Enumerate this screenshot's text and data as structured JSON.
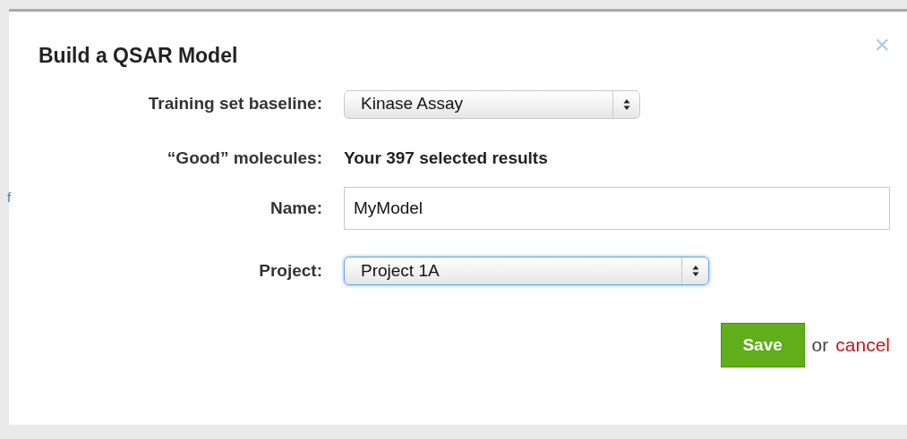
{
  "background": {
    "fragment": "f"
  },
  "dialog": {
    "title": "Build a QSAR Model",
    "close": "×",
    "fields": [
      {
        "kind": "select",
        "label": "Training set baseline:",
        "value": "Kinase Assay",
        "focused": false
      },
      {
        "kind": "text",
        "label": "“Good” molecules:",
        "value": "Your 397 selected results"
      },
      {
        "kind": "input",
        "label": "Name:",
        "value": "MyModel",
        "focused": false
      },
      {
        "kind": "select",
        "label": "Project:",
        "value": "Project 1A",
        "focused": true
      }
    ],
    "footer": {
      "save": "Save",
      "or": "or",
      "cancel": "cancel"
    }
  }
}
